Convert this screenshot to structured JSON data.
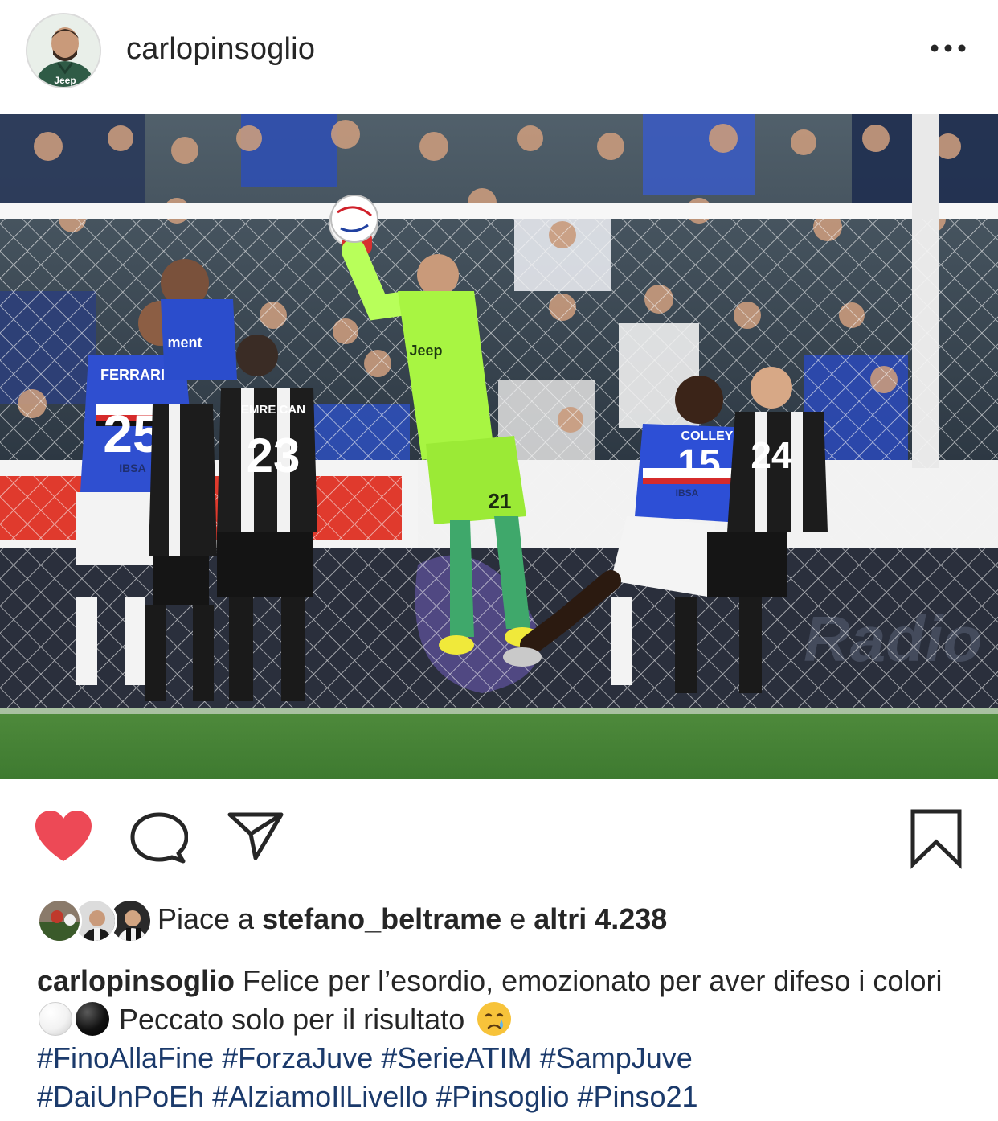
{
  "post": {
    "username": "carlopinsoglio",
    "icons": {
      "more": "more-options-icon",
      "like": "heart-icon",
      "comment": "comment-icon",
      "share": "share-icon",
      "save": "bookmark-icon"
    },
    "liked": true,
    "colors": {
      "like_red": "#ed4956",
      "hashtag_blue": "#1b3a6b",
      "text": "#262626"
    }
  },
  "likes": {
    "prefix": "Piace a ",
    "user": "stefano_beltrame",
    "middle": " e ",
    "count": "altri 4.238"
  },
  "caption": {
    "username": "carlopinsoglio",
    "text_1": " Felice per l’esordio, emozionato per aver difeso i colori ",
    "text_2": " Peccato solo per il risultato ",
    "emoji_1": "white-circle-emoji",
    "emoji_2": "black-circle-emoji",
    "emoji_3": "crying-face-emoji",
    "hashtags": [
      "#FinoAllaFine",
      "#ForzaJuve",
      "#SerieATIM",
      "#SampJuve",
      "#DaiUnPoEh",
      "#AlziamoIlLivello",
      "#Pinsoglio",
      "#Pinso21"
    ]
  },
  "photo": {
    "jersey_numbers": [
      "25",
      "23",
      "21",
      "15",
      "24"
    ],
    "jersey_names": [
      "FERRARI",
      "EMRE CAN",
      "COLLEY"
    ],
    "sponsor": "IBSA",
    "shirt_brand": "Jeep"
  }
}
